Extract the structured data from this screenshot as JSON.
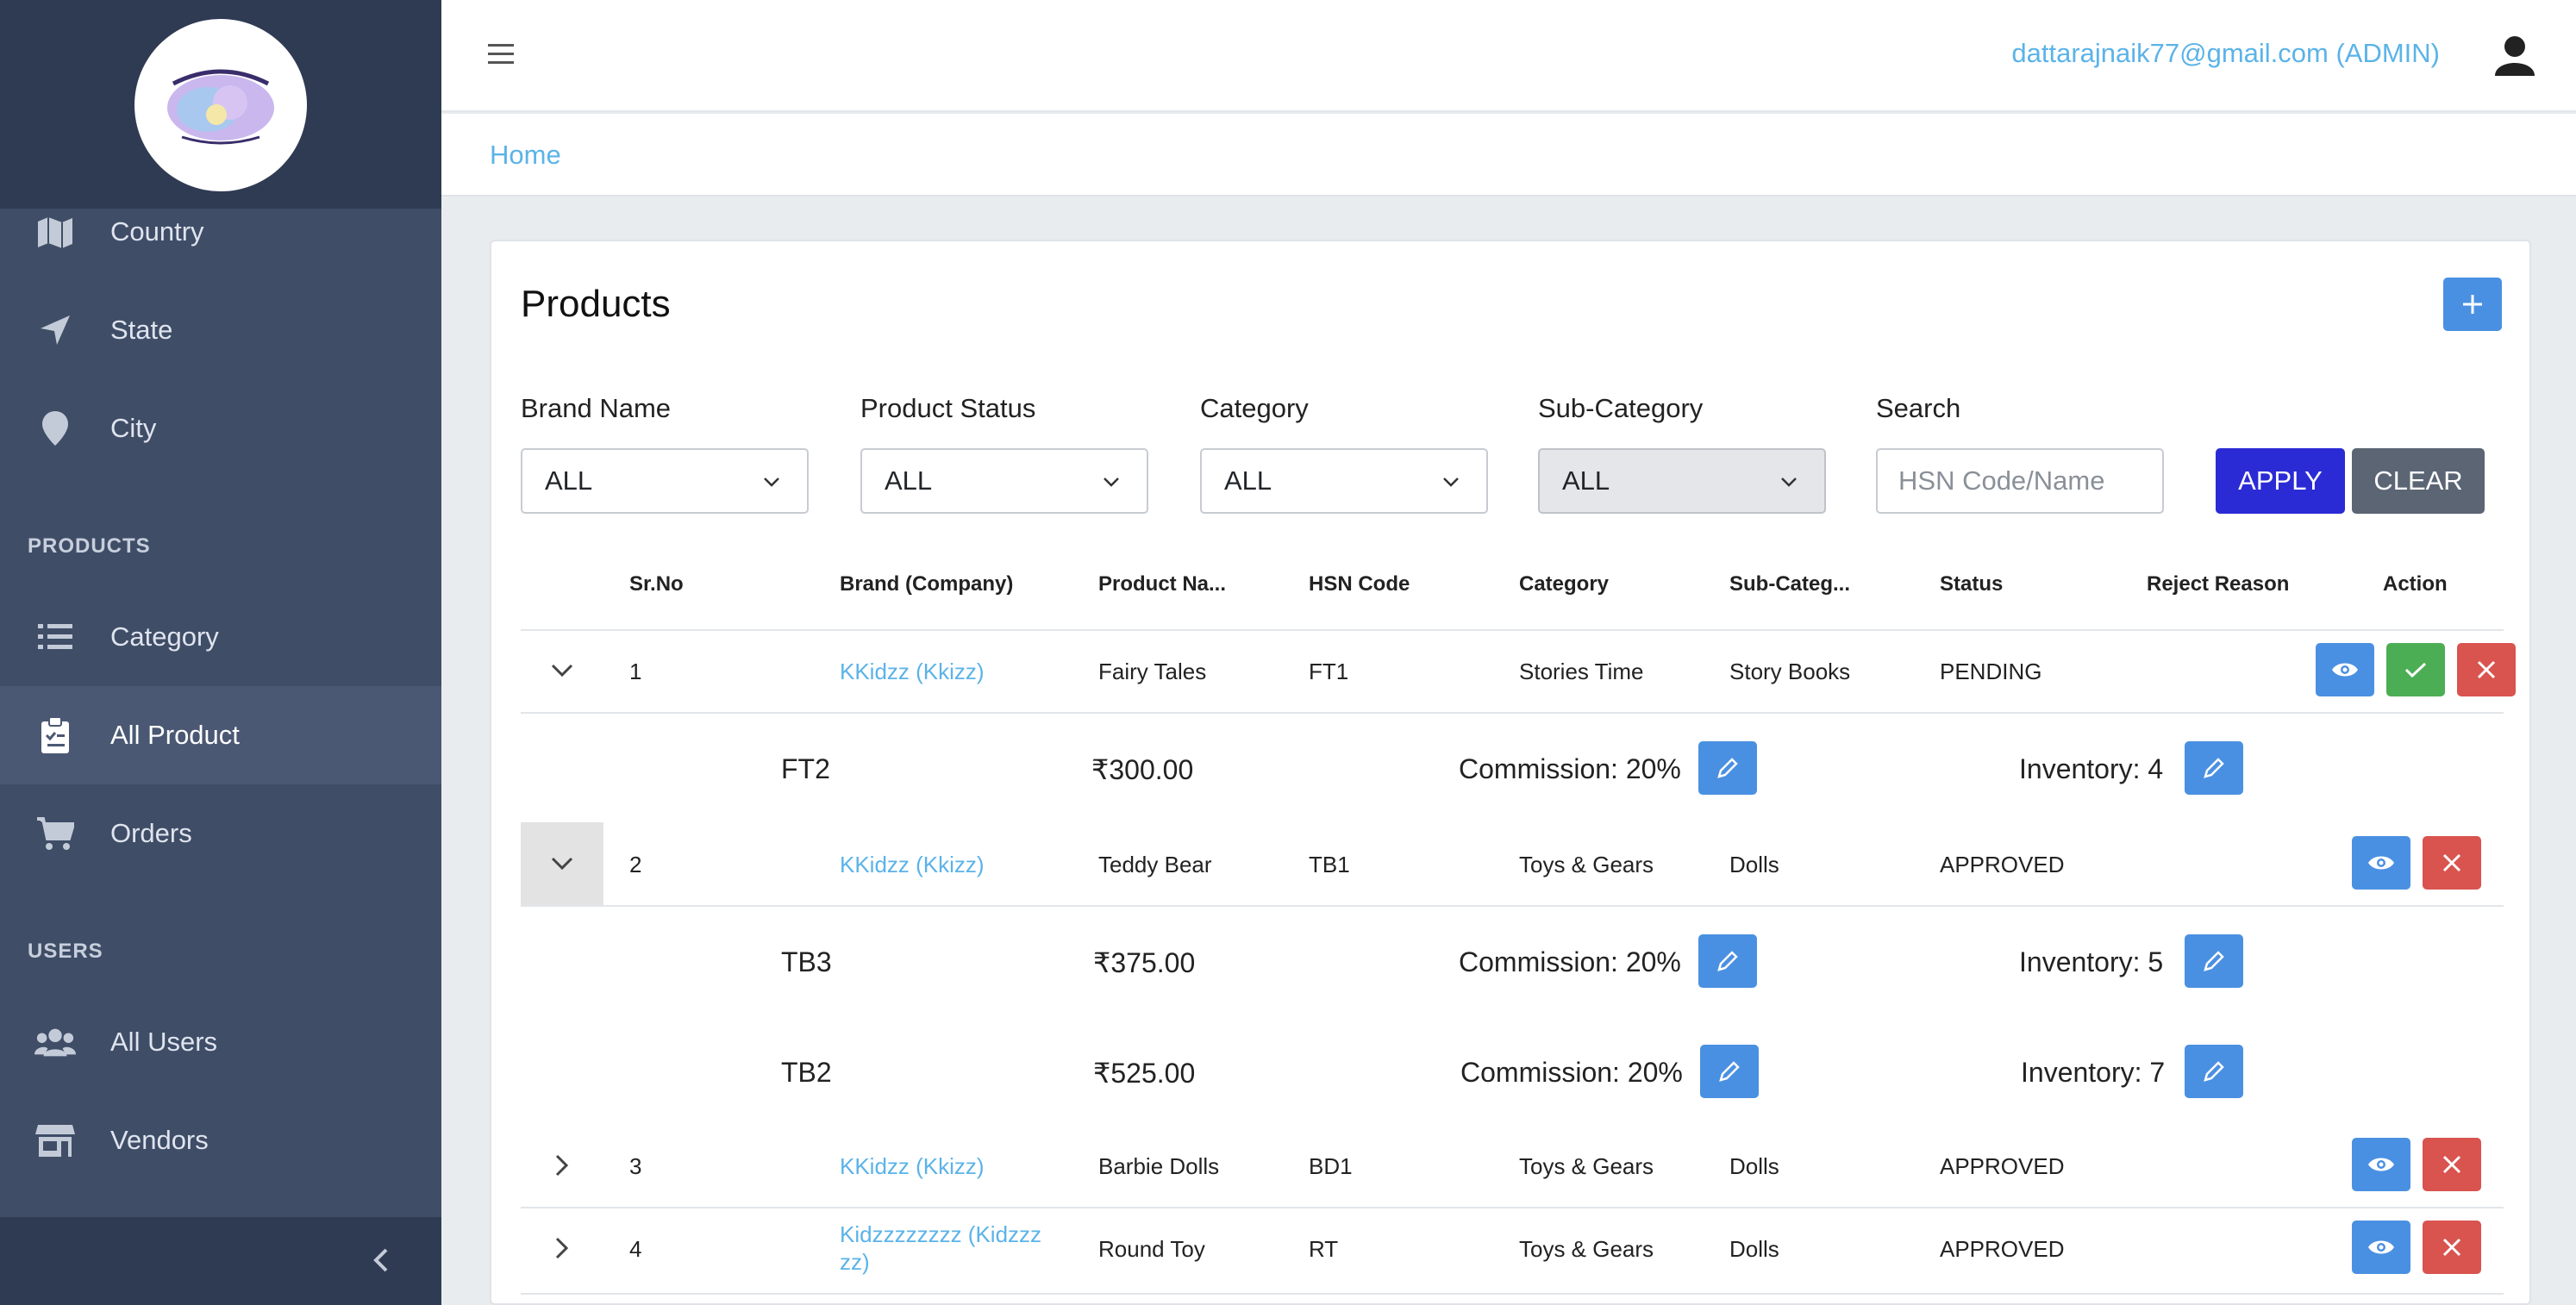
{
  "sidebar": {
    "items": [
      {
        "label": "Country",
        "icon": "map-icon"
      },
      {
        "label": "State",
        "icon": "location-arrow-icon"
      },
      {
        "label": "City",
        "icon": "map-pin-icon"
      },
      {
        "label": "Category",
        "icon": "list-icon"
      },
      {
        "label": "All Product",
        "icon": "clipboard-icon",
        "active": true
      },
      {
        "label": "Orders",
        "icon": "cart-icon"
      },
      {
        "label": "All Users",
        "icon": "users-icon"
      },
      {
        "label": "Vendors",
        "icon": "store-icon"
      }
    ],
    "sections": {
      "products": "PRODUCTS",
      "users": "USERS"
    }
  },
  "header": {
    "user_email": "dattarajnaik77@gmail.com (ADMIN)"
  },
  "breadcrumb": "Home",
  "page": {
    "title": "Products",
    "filters": {
      "brand": {
        "label": "Brand Name",
        "value": "ALL"
      },
      "status": {
        "label": "Product Status",
        "value": "ALL"
      },
      "category": {
        "label": "Category",
        "value": "ALL"
      },
      "subcategory": {
        "label": "Sub-Category",
        "value": "ALL"
      },
      "search": {
        "label": "Search",
        "placeholder": "HSN Code/Name"
      }
    },
    "apply_label": "APPLY",
    "clear_label": "CLEAR"
  },
  "table": {
    "columns": [
      "Sr.No",
      "Brand (Company)",
      "Product Na...",
      "HSN Code",
      "Category",
      "Sub-Categ...",
      "Status",
      "Reject Reason",
      "Action"
    ],
    "rows": [
      {
        "srno": "1",
        "brand": "KKidzz (Kkizz)",
        "product": "Fairy Tales",
        "hsn": "FT1",
        "category": "Stories Time",
        "subcategory": "Story Books",
        "status": "PENDING",
        "reject_reason": ""
      },
      {
        "srno": "2",
        "brand": "KKidzz (Kkizz)",
        "product": "Teddy Bear",
        "hsn": "TB1",
        "category": "Toys & Gears",
        "subcategory": "Dolls",
        "status": "APPROVED",
        "reject_reason": ""
      },
      {
        "srno": "3",
        "brand": "KKidzz (Kkizz)",
        "product": "Barbie Dolls",
        "hsn": "BD1",
        "category": "Toys & Gears",
        "subcategory": "Dolls",
        "status": "APPROVED",
        "reject_reason": ""
      },
      {
        "srno": "4",
        "brand_line1": "Kidzzzzzzzz (Kidzzz",
        "brand_line2": "zz)",
        "product": "Round Toy",
        "hsn": "RT",
        "category": "Toys & Gears",
        "subcategory": "Dolls",
        "status": "APPROVED",
        "reject_reason": ""
      }
    ],
    "variants": [
      {
        "code": "FT2",
        "price": "₹300.00",
        "commission": "Commission: 20%",
        "inventory": "Inventory: 4"
      },
      {
        "code": "TB3",
        "price": "₹375.00",
        "commission": "Commission: 20%",
        "inventory": "Inventory: 5"
      },
      {
        "code": "TB2",
        "price": "₹525.00",
        "commission": "Commission: 20%",
        "inventory": "Inventory: 7"
      }
    ]
  },
  "colors": {
    "sidebar": "#3f4d67",
    "primary": "#4a90e2",
    "apply": "#2b2bd6",
    "danger": "#d9534f",
    "success": "#4cae54",
    "link": "#5bb3e8"
  }
}
